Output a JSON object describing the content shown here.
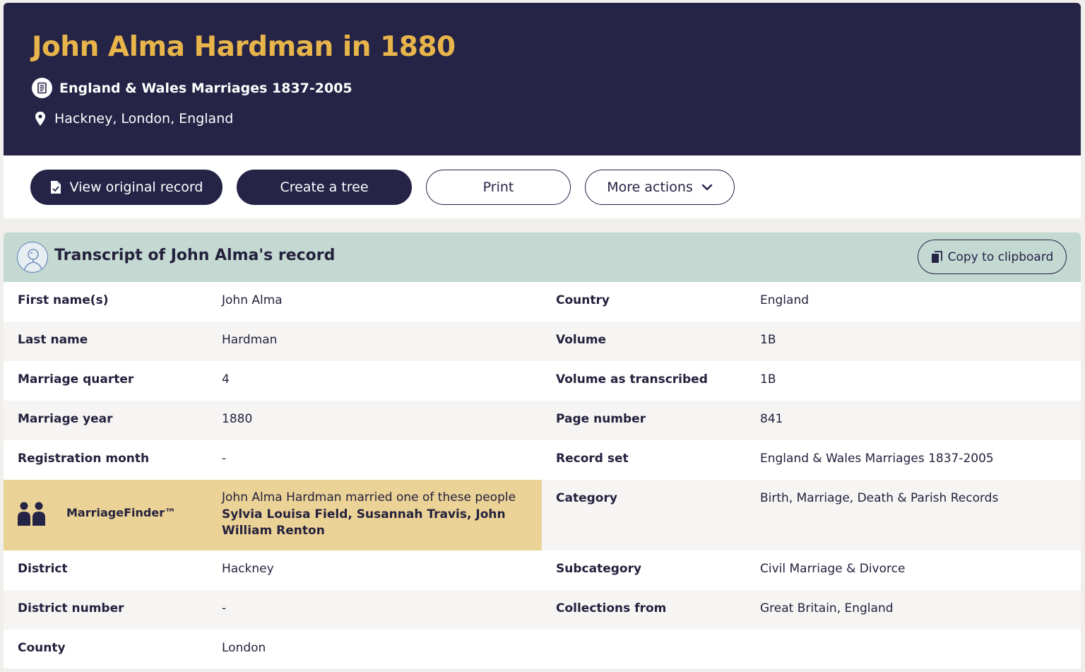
{
  "header": {
    "title": "John Alma Hardman in 1880",
    "collection": "England & Wales Marriages 1837-2005",
    "location": "Hackney, London, England"
  },
  "actions": {
    "view_original": "View original record",
    "create_tree": "Create a tree",
    "print": "Print",
    "more_actions": "More actions"
  },
  "transcript": {
    "title": "Transcript of John Alma's record",
    "copy_label": "Copy to clipboard"
  },
  "left_fields": [
    {
      "label": "First name(s)",
      "value": "John Alma"
    },
    {
      "label": "Last name",
      "value": "Hardman"
    },
    {
      "label": "Marriage quarter",
      "value": "4"
    },
    {
      "label": "Marriage year",
      "value": "1880"
    },
    {
      "label": "Registration month",
      "value": "-"
    },
    {
      "label": "District",
      "value": "Hackney"
    },
    {
      "label": "District number",
      "value": "-"
    },
    {
      "label": "County",
      "value": "London"
    }
  ],
  "right_fields": [
    {
      "label": "Country",
      "value": "England"
    },
    {
      "label": "Volume",
      "value": "1B"
    },
    {
      "label": "Volume as transcribed",
      "value": "1B"
    },
    {
      "label": "Page number",
      "value": "841"
    },
    {
      "label": "Record set",
      "value": "England & Wales Marriages 1837-2005"
    },
    {
      "label": "Category",
      "value": "Birth, Marriage, Death & Parish Records"
    },
    {
      "label": "Subcategory",
      "value": "Civil Marriage & Divorce"
    },
    {
      "label": "Collections from",
      "value": "Great Britain, England"
    }
  ],
  "marriage_finder": {
    "label": "MarriageFinder™",
    "intro": "John Alma Hardman married one of these people",
    "names": "Sylvia Louisa Field, Susannah Travis, John William Renton"
  },
  "colors": {
    "navy": "#252346",
    "gold": "#e8b54a",
    "mint": "#c5d9d3",
    "finder": "#ebd296"
  }
}
